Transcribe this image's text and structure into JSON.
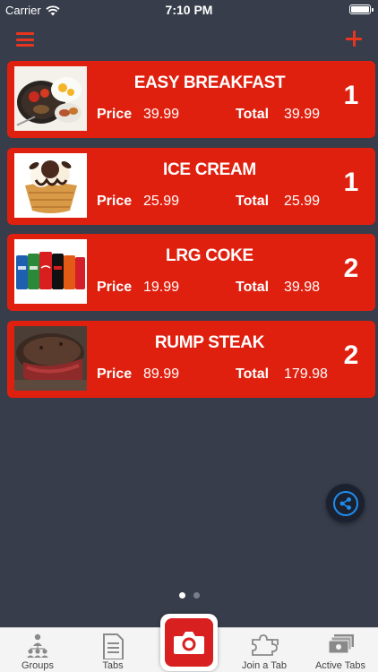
{
  "status_bar": {
    "carrier": "Carrier",
    "time": "7:10 PM"
  },
  "nav": {
    "menu_icon": "hamburger-menu-icon",
    "add_icon": "plus-icon",
    "accent_color": "#e8351f"
  },
  "items": [
    {
      "name": "EASY BREAKFAST",
      "price_label": "Price",
      "price": "39.99",
      "total_label": "Total",
      "total": "39.99",
      "qty": "1",
      "image": "breakfast-plate"
    },
    {
      "name": "ICE CREAM",
      "price_label": "Price",
      "price": "25.99",
      "total_label": "Total",
      "total": "25.99",
      "qty": "1",
      "image": "ice-cream-bowl"
    },
    {
      "name": "LRG COKE",
      "price_label": "Price",
      "price": "19.99",
      "total_label": "Total",
      "total": "39.98",
      "qty": "2",
      "image": "soda-cans"
    },
    {
      "name": "RUMP STEAK",
      "price_label": "Price",
      "price": "89.99",
      "total_label": "Total",
      "total": "179.98",
      "qty": "2",
      "image": "steak"
    }
  ],
  "share_icon": "share-icon",
  "pages": {
    "count": 2,
    "current": 1
  },
  "tab_bar": {
    "tabs": [
      {
        "label": "Groups",
        "icon": "groups-icon"
      },
      {
        "label": "Tabs",
        "icon": "document-icon"
      },
      {
        "label": "Join a Tab",
        "icon": "puzzle-icon"
      },
      {
        "label": "Active Tabs",
        "icon": "bills-icon"
      }
    ],
    "center_icon": "camera-icon"
  },
  "colors": {
    "background": "#373d4b",
    "card": "#e0200f",
    "share_accent": "#1d8ef0",
    "camera": "#d92020"
  }
}
